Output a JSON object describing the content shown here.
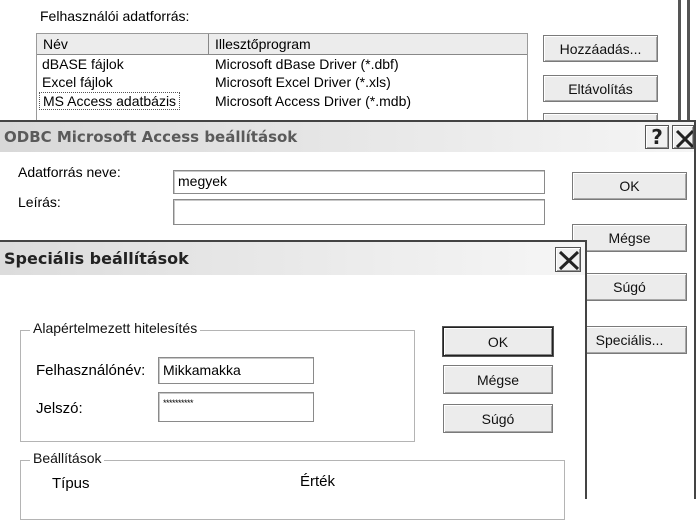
{
  "bg_window": {
    "user_sources_label": "Felhasználói adatforrás:",
    "columns": [
      "Név",
      "Illesztőprogram"
    ],
    "rows": [
      {
        "name": "dBASE fájlok",
        "driver": "Microsoft dBase Driver (*.dbf)"
      },
      {
        "name": "Excel fájlok",
        "driver": "Microsoft Excel Driver (*.xls)"
      },
      {
        "name": "MS Access adatbázis",
        "driver": "Microsoft Access Driver (*.mdb)"
      }
    ],
    "add_button": "Hozzáadás...",
    "remove_button": "Eltávolítás"
  },
  "access_dialog": {
    "title": "ODBC Microsoft Access beállítások",
    "help_glyph": "?",
    "datasource_label": "Adatforrás neve:",
    "datasource_value": "megyek",
    "description_label": "Leírás:",
    "description_value": "",
    "ok_button": "OK",
    "cancel_button": "Mégse",
    "help_button": "Súgó",
    "advanced_button": "Speciális..."
  },
  "advanced_dialog": {
    "title": "Speciális beállítások",
    "auth_group_label": "Alapértelmezett hitelesítés",
    "username_label": "Felhasználónév:",
    "username_value": "Mikkamakka",
    "password_label": "Jelszó:",
    "password_value": "**********",
    "ok_button": "OK",
    "cancel_button": "Mégse",
    "help_button": "Súgó",
    "options_group_label": "Beállítások",
    "options_col_type": "Típus",
    "options_col_value": "Érték"
  },
  "colors": {
    "title_gradient_start": "#dcdcdc",
    "title_gradient_end": "#f6f6f6",
    "title_text": "#5a5a5a",
    "window_bg": "#ffffff",
    "border": "#444444"
  }
}
